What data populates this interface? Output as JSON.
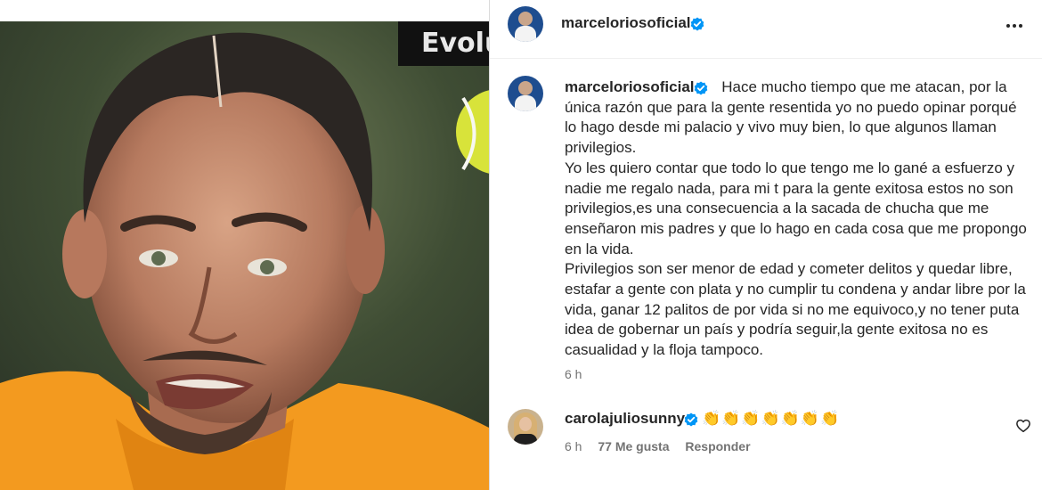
{
  "media": {
    "overlay_label": "Evolu"
  },
  "post": {
    "username": "marceloriosoficial",
    "verified": true,
    "caption_paragraphs": [
      "Hace mucho tiempo que me atacan, por la única razón que para la gente resentida yo no puedo opinar porqué lo hago desde mi palacio y vivo muy bien, lo que algunos llaman privilegios.",
      "Yo les quiero contar que todo lo que tengo me lo gané a esfuerzo y nadie me regalo nada, para mi t para la gente exitosa estos no son privilegios,es una consecuencia a la sacada de chucha que me enseñaron mis padres y que lo hago en cada cosa que me propongo en la vida.",
      "Privilegios son ser menor de edad y cometer delitos y quedar libre, estafar a gente con plata y no cumplir tu condena y andar libre por la vida, ganar 12 palitos de por vida si no me equivoco,y no tener puta idea de gobernar un país y podría seguir,la gente exitosa no es casualidad y la floja tampoco."
    ],
    "time": "6 h"
  },
  "comment": {
    "username": "carolajuliosunny",
    "verified": true,
    "text": "👏👏👏👏👏👏👏",
    "time": "6 h",
    "likes": "77 Me gusta",
    "reply_label": "Responder"
  },
  "icons": {
    "more": "more-icon",
    "verified": "verified-badge-icon",
    "like": "heart-icon"
  },
  "colors": {
    "verified": "#0095f6",
    "text": "#262626",
    "secondary": "#737373",
    "shirt": "#f39a1f"
  }
}
